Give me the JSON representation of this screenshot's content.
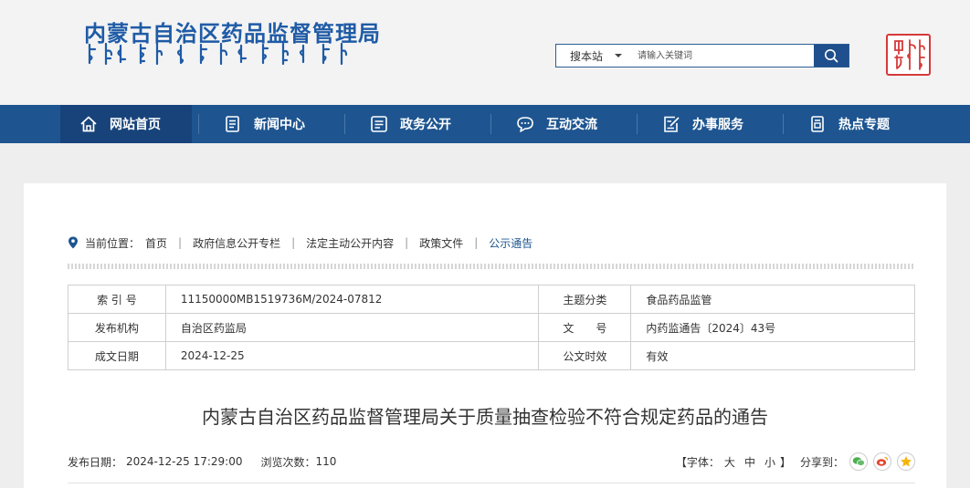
{
  "header": {
    "site_title": "内蒙古自治区药品监督管理局",
    "search": {
      "scope_label": "搜本站",
      "placeholder": "请输入关键词"
    }
  },
  "nav": {
    "items": [
      {
        "label": "网站首页",
        "icon": "home-icon"
      },
      {
        "label": "新闻中心",
        "icon": "news-icon"
      },
      {
        "label": "政务公开",
        "icon": "document-icon"
      },
      {
        "label": "互动交流",
        "icon": "chat-icon"
      },
      {
        "label": "办事服务",
        "icon": "edit-icon"
      },
      {
        "label": "热点专题",
        "icon": "topic-icon"
      }
    ]
  },
  "breadcrumb": {
    "label": "当前位置：",
    "items": [
      "首页",
      "政府信息公开专栏",
      "法定主动公开内容",
      "政策文件",
      "公示通告"
    ]
  },
  "meta": {
    "rows": [
      {
        "l1": "索 引 号",
        "v1": "11150000MB1519736M/2024-07812",
        "l2": "主题分类",
        "v2": "食品药品监管"
      },
      {
        "l1": "发布机构",
        "v1": "自治区药监局",
        "l2": "文　　号",
        "v2": "内药监通告〔2024〕43号"
      },
      {
        "l1": "成文日期",
        "v1": "2024-12-25",
        "l2": "公文时效",
        "v2": "有效"
      }
    ]
  },
  "article": {
    "title": "内蒙古自治区药品监督管理局关于质量抽查检验不符合规定药品的通告",
    "publish_label": "发布日期：",
    "publish_date": "2024-12-25 17:29:00",
    "views_label": "浏览次数：",
    "views": "110",
    "font_label": "【字体：",
    "font_large": "大",
    "font_medium": "中",
    "font_small": "小",
    "font_end": "】",
    "share_label": "分享到："
  },
  "colors": {
    "brand_blue": "#1e5590",
    "nav_active": "#17437a",
    "seal_red": "#d53a3a"
  }
}
